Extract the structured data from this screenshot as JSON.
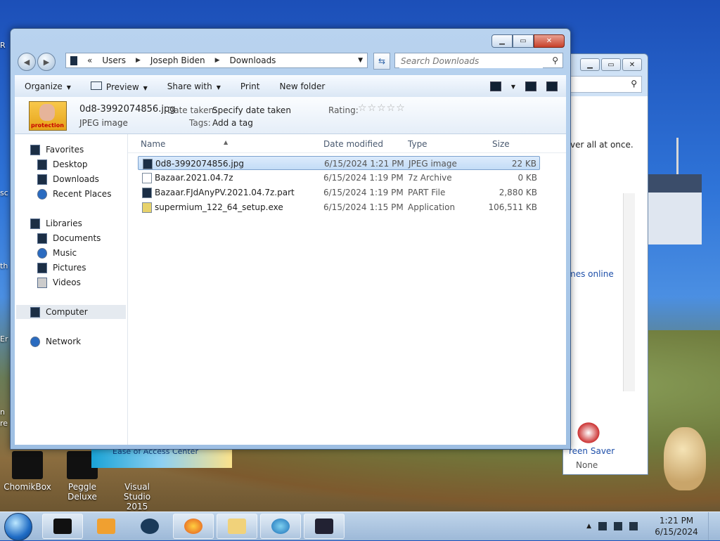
{
  "desktop": {
    "icons": [
      {
        "label": "ChomikBox"
      },
      {
        "label": "Peggle Deluxe"
      },
      {
        "label": "Visual Studio 2015"
      }
    ],
    "edge_texts": [
      "R",
      "sc",
      "th",
      "Er",
      "n",
      "re"
    ]
  },
  "back_window": {
    "text": "ver all at once.",
    "link": "mes online",
    "screen_saver_label": "reen Saver",
    "screen_saver_value": "None",
    "banner": "Ease of Access Center"
  },
  "explorer": {
    "breadcrumb": [
      "Users",
      "Joseph Biden",
      "Downloads"
    ],
    "search_placeholder": "Search Downloads",
    "toolbar": {
      "organize": "Organize",
      "preview": "Preview",
      "share_with": "Share with",
      "print": "Print",
      "new_folder": "New folder"
    },
    "details": {
      "thumb_text": "protection",
      "filename": "0d8-3992074856.jpg",
      "filetype": "JPEG image",
      "date_taken_label": "Date taken:",
      "date_taken_value": "Specify date taken",
      "tags_label": "Tags:",
      "tags_value": "Add a tag",
      "rating_label": "Rating:",
      "rating_stars": "☆☆☆☆☆"
    },
    "nav": {
      "favorites": "Favorites",
      "desktop": "Desktop",
      "downloads": "Downloads",
      "recent_places": "Recent Places",
      "libraries": "Libraries",
      "documents": "Documents",
      "music": "Music",
      "pictures": "Pictures",
      "videos": "Videos",
      "computer": "Computer",
      "network": "Network"
    },
    "columns": {
      "name": "Name",
      "date": "Date modified",
      "type": "Type",
      "size": "Size"
    },
    "files": [
      {
        "name": "0d8-3992074856.jpg",
        "date": "6/15/2024 1:21 PM",
        "type": "JPEG image",
        "size": "22 KB"
      },
      {
        "name": "Bazaar.2021.04.7z",
        "date": "6/15/2024 1:19 PM",
        "type": "7z Archive",
        "size": "0 KB"
      },
      {
        "name": "Bazaar.FJdAnyPV.2021.04.7z.part",
        "date": "6/15/2024 1:19 PM",
        "type": "PART File",
        "size": "2,880 KB"
      },
      {
        "name": "supermium_122_64_setup.exe",
        "date": "6/15/2024 1:15 PM",
        "type": "Application",
        "size": "106,511 KB"
      }
    ]
  },
  "taskbar": {
    "time": "1:21 PM",
    "date": "6/15/2024"
  },
  "colors": {
    "selection": "#cfe3fa",
    "link": "#1e4fa9",
    "close_button": "#c7402a"
  }
}
